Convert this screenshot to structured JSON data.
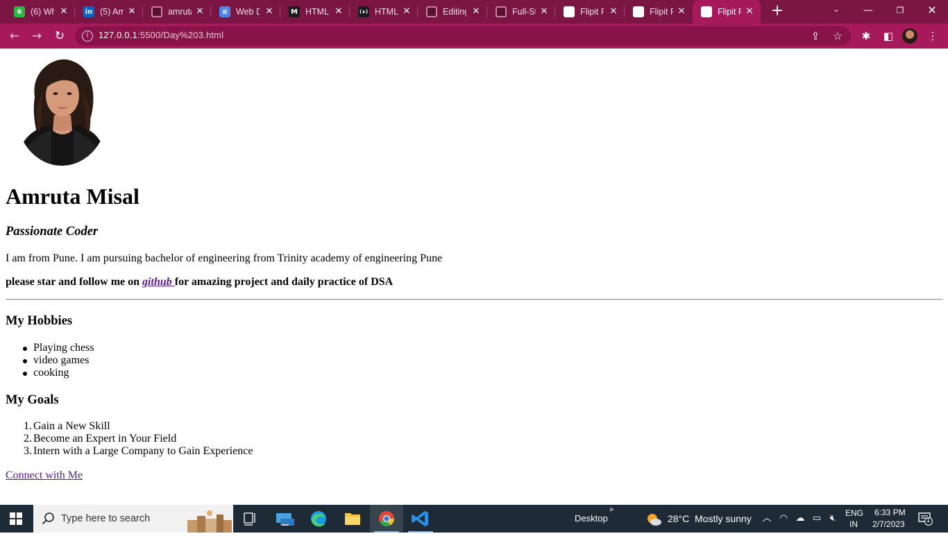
{
  "browser": {
    "tabs": [
      {
        "title": "(6) Wh",
        "favicon": "whatsapp-icon",
        "badge": "6"
      },
      {
        "title": "(5) Am",
        "favicon": "linkedin-icon",
        "badge": "in"
      },
      {
        "title": "amruta",
        "favicon": "github-icon"
      },
      {
        "title": "Web D",
        "favicon": "google-docs-icon"
      },
      {
        "title": "HTML",
        "favicon": "m-logo-icon",
        "badge": "M"
      },
      {
        "title": "HTML",
        "favicon": "code-logo-icon",
        "badge": "(∧)"
      },
      {
        "title": "Editing",
        "favicon": "github-icon"
      },
      {
        "title": "Full-St",
        "favicon": "github-icon"
      },
      {
        "title": "Flipit P",
        "favicon": "globe-icon"
      },
      {
        "title": "Flipit P",
        "favicon": "globe-icon"
      },
      {
        "title": "Flipit P",
        "favicon": "globe-icon",
        "active": true
      }
    ],
    "address": {
      "host": "127.0.0.1",
      "path": ":5500/Day%203.html"
    },
    "colors": {
      "tabstrip": "#7b1544",
      "toolbar": "#a6195a"
    }
  },
  "page": {
    "name": "Amruta Misal",
    "tagline": "Passionate Coder",
    "intro": "I am from Pune. I am pursuing bachelor of engineering from Trinity academy of engineering Pune",
    "follow": {
      "before": "please star and follow me on ",
      "link": "github ",
      "after": "for amazing project and daily practice of DSA"
    },
    "hobbies": {
      "heading": "My Hobbies",
      "items": [
        "Playing chess",
        "video games",
        "cooking"
      ]
    },
    "goals": {
      "heading": "My Goals",
      "items": [
        "Gain a New Skill",
        "Become an Expert in Your Field",
        "Intern with a Large Company to Gain Experience"
      ]
    },
    "connect": "Connect with Me",
    "link_color": "#551a8b"
  },
  "taskbar": {
    "search_placeholder": "Type here to search",
    "desktop_label": "Desktop",
    "weather": {
      "temp": "28°C",
      "condition": "Mostly sunny"
    },
    "language": {
      "line1": "ENG",
      "line2": "IN"
    },
    "clock": {
      "time": "6:33 PM",
      "date": "2/7/2023"
    },
    "notification_count": "1"
  }
}
